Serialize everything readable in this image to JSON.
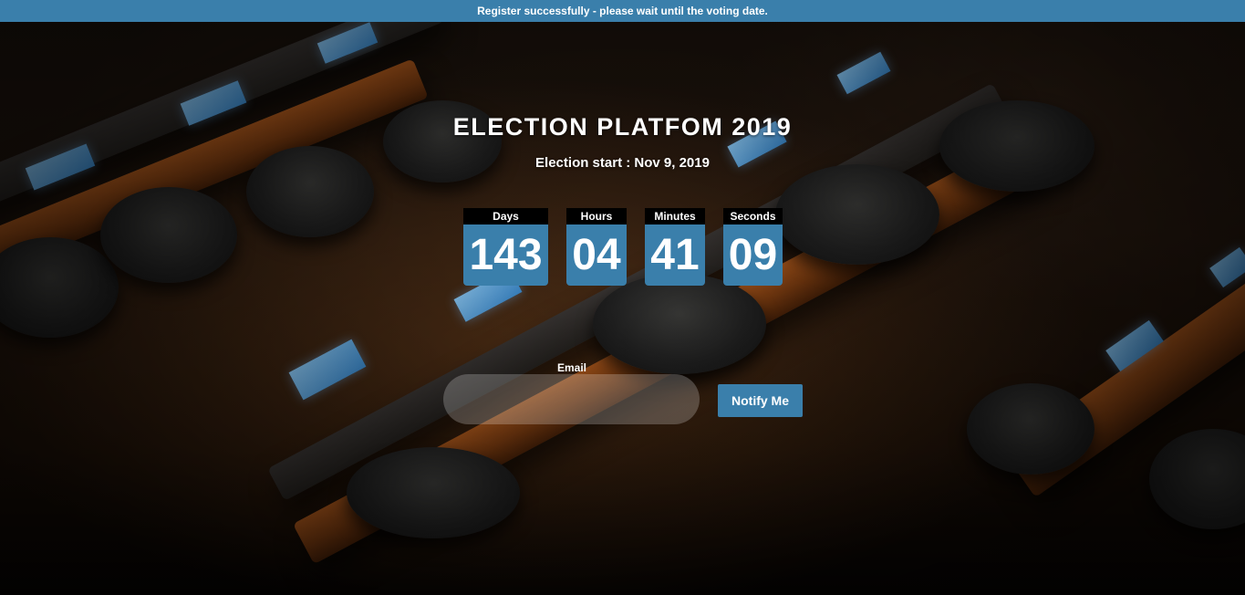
{
  "banner": {
    "message": "Register successfully - please wait until the voting date."
  },
  "header": {
    "title": "ELECTION PLATFOM 2019",
    "subtitle": "Election start : Nov 9, 2019"
  },
  "countdown": {
    "units": [
      {
        "label": "Days",
        "value": "143"
      },
      {
        "label": "Hours",
        "value": "04"
      },
      {
        "label": "Minutes",
        "value": "41"
      },
      {
        "label": "Seconds",
        "value": "09"
      }
    ]
  },
  "form": {
    "email_label": "Email",
    "email_value": "",
    "button_label": "Notify Me"
  },
  "colors": {
    "accent": "#3a7fab",
    "label_background": "#000000",
    "text": "#ffffff"
  }
}
